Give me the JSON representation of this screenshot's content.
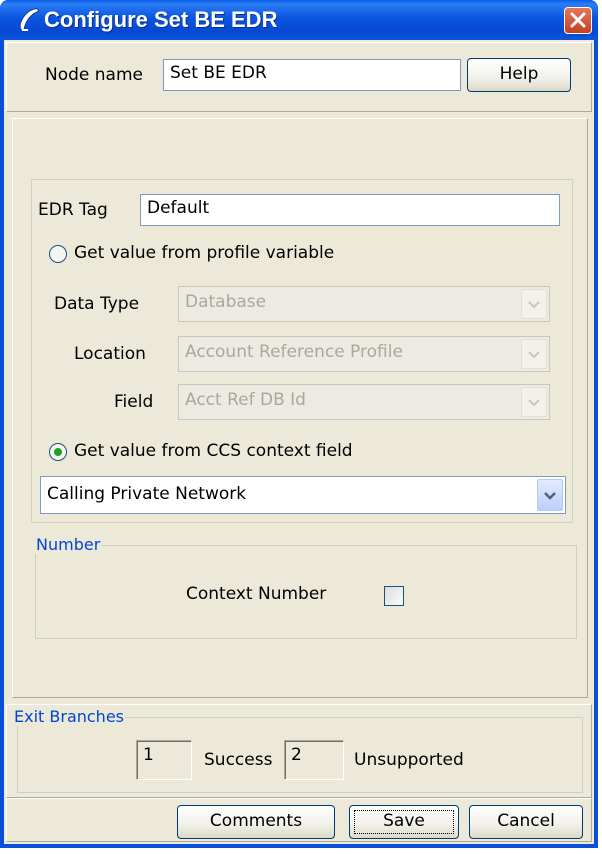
{
  "window": {
    "title": "Configure Set BE EDR"
  },
  "node": {
    "label": "Node name",
    "value": "Set BE EDR",
    "help_label": "Help"
  },
  "edr": {
    "tag_label": "EDR Tag",
    "tag_value": "Default",
    "radio_profile_label": "Get value from profile variable",
    "radio_profile_selected": false,
    "data_type_label": "Data Type",
    "data_type_value": "Database",
    "location_label": "Location",
    "location_value": "Account Reference Profile",
    "field_label": "Field",
    "field_value": "Acct Ref DB Id",
    "radio_ccs_label": "Get value from CCS context field",
    "radio_ccs_selected": true,
    "ccs_value": "Calling Private Network"
  },
  "number": {
    "legend": "Number",
    "context_label": "Context Number",
    "context_checked": false
  },
  "exits": {
    "legend": "Exit Branches",
    "branch1_number": "1",
    "branch1_label": "Success",
    "branch2_number": "2",
    "branch2_label": "Unsupported"
  },
  "footer": {
    "comments_label": "Comments",
    "save_label": "Save",
    "cancel_label": "Cancel"
  },
  "colors": {
    "titlebar": "#0a55e0",
    "window_bg": "#ece9d8",
    "legend_text": "#0046d5"
  }
}
